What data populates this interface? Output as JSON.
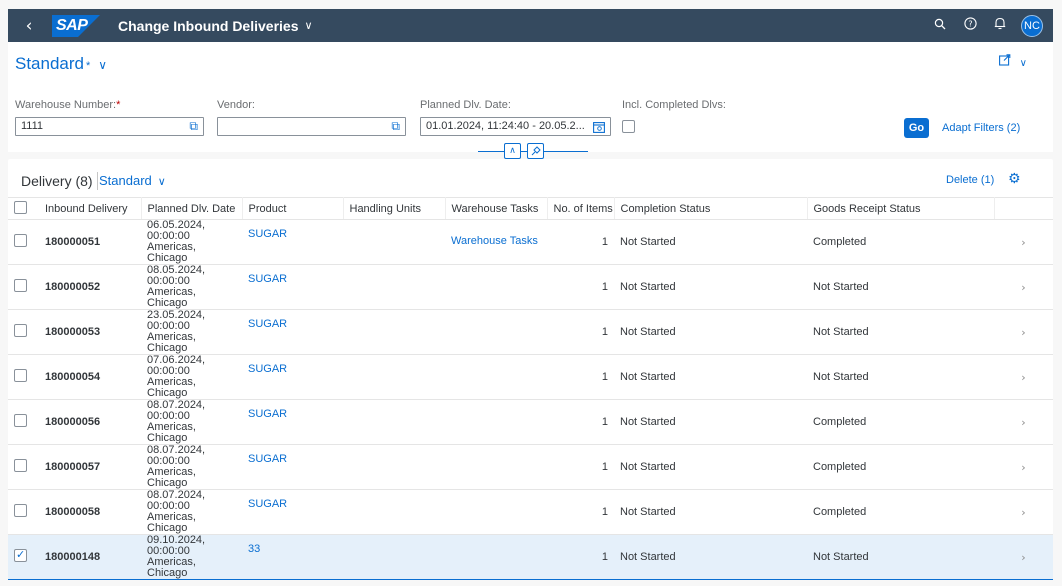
{
  "shell": {
    "back_icon": "chevron-left-icon",
    "logo_text": "SAP",
    "title": "Change Inbound Deliveries",
    "title_chevron": "∨",
    "avatar_initials": "NC",
    "brand_color": "#354a5f",
    "accent_color": "#0a6ed1"
  },
  "header": {
    "variant_name": "Standard",
    "variant_modified_mark": "*",
    "filters": {
      "warehouse_label": "Warehouse Number:",
      "warehouse_required": "*",
      "warehouse_value": "1111",
      "vendor_label": "Vendor:",
      "vendor_value": "",
      "planned_date_label": "Planned Dlv. Date:",
      "planned_date_value": "01.01.2024, 11:24:40 - 20.05.2...",
      "completed_label": "Incl. Completed Dlvs:",
      "completed_checked": false
    },
    "go_label": "Go",
    "adapt_filters_label": "Adapt Filters (2)"
  },
  "table": {
    "title": "Delivery (8)",
    "variant_name": "Standard",
    "delete_label": "Delete (1)",
    "columns": {
      "inbound_delivery": "Inbound Delivery",
      "planned_date": "Planned Dlv. Date",
      "product": "Product",
      "handling_units": "Handling Units",
      "warehouse_tasks": "Warehouse Tasks",
      "no_of_items": "No. of Items",
      "completion_status": "Completion Status",
      "goods_receipt_status": "Goods Receipt Status"
    },
    "rows": [
      {
        "id": "180000051",
        "date_line1": "06.05.2024,",
        "date_line2": "00:00:00 Americas,",
        "date_line3": "Chicago",
        "product": "SUGAR",
        "handling_units": "",
        "warehouse_tasks": "Warehouse Tasks",
        "items": "1",
        "completion": "Not Started",
        "goods_receipt": "Completed",
        "selected": false
      },
      {
        "id": "180000052",
        "date_line1": "08.05.2024,",
        "date_line2": "00:00:00 Americas,",
        "date_line3": "Chicago",
        "product": "SUGAR",
        "handling_units": "",
        "warehouse_tasks": "",
        "items": "1",
        "completion": "Not Started",
        "goods_receipt": "Not Started",
        "selected": false
      },
      {
        "id": "180000053",
        "date_line1": "23.05.2024,",
        "date_line2": "00:00:00 Americas,",
        "date_line3": "Chicago",
        "product": "SUGAR",
        "handling_units": "",
        "warehouse_tasks": "",
        "items": "1",
        "completion": "Not Started",
        "goods_receipt": "Not Started",
        "selected": false
      },
      {
        "id": "180000054",
        "date_line1": "07.06.2024,",
        "date_line2": "00:00:00 Americas,",
        "date_line3": "Chicago",
        "product": "SUGAR",
        "handling_units": "",
        "warehouse_tasks": "",
        "items": "1",
        "completion": "Not Started",
        "goods_receipt": "Not Started",
        "selected": false
      },
      {
        "id": "180000056",
        "date_line1": "08.07.2024,",
        "date_line2": "00:00:00 Americas,",
        "date_line3": "Chicago",
        "product": "SUGAR",
        "handling_units": "",
        "warehouse_tasks": "",
        "items": "1",
        "completion": "Not Started",
        "goods_receipt": "Completed",
        "selected": false
      },
      {
        "id": "180000057",
        "date_line1": "08.07.2024,",
        "date_line2": "00:00:00 Americas,",
        "date_line3": "Chicago",
        "product": "SUGAR",
        "handling_units": "",
        "warehouse_tasks": "",
        "items": "1",
        "completion": "Not Started",
        "goods_receipt": "Completed",
        "selected": false
      },
      {
        "id": "180000058",
        "date_line1": "08.07.2024,",
        "date_line2": "00:00:00 Americas,",
        "date_line3": "Chicago",
        "product": "SUGAR",
        "handling_units": "",
        "warehouse_tasks": "",
        "items": "1",
        "completion": "Not Started",
        "goods_receipt": "Completed",
        "selected": false
      },
      {
        "id": "180000148",
        "date_line1": "09.10.2024,",
        "date_line2": "00:00:00 Americas,",
        "date_line3": "Chicago",
        "product": "33",
        "handling_units": "",
        "warehouse_tasks": "",
        "items": "1",
        "completion": "Not Started",
        "goods_receipt": "Not Started",
        "selected": true
      }
    ]
  }
}
